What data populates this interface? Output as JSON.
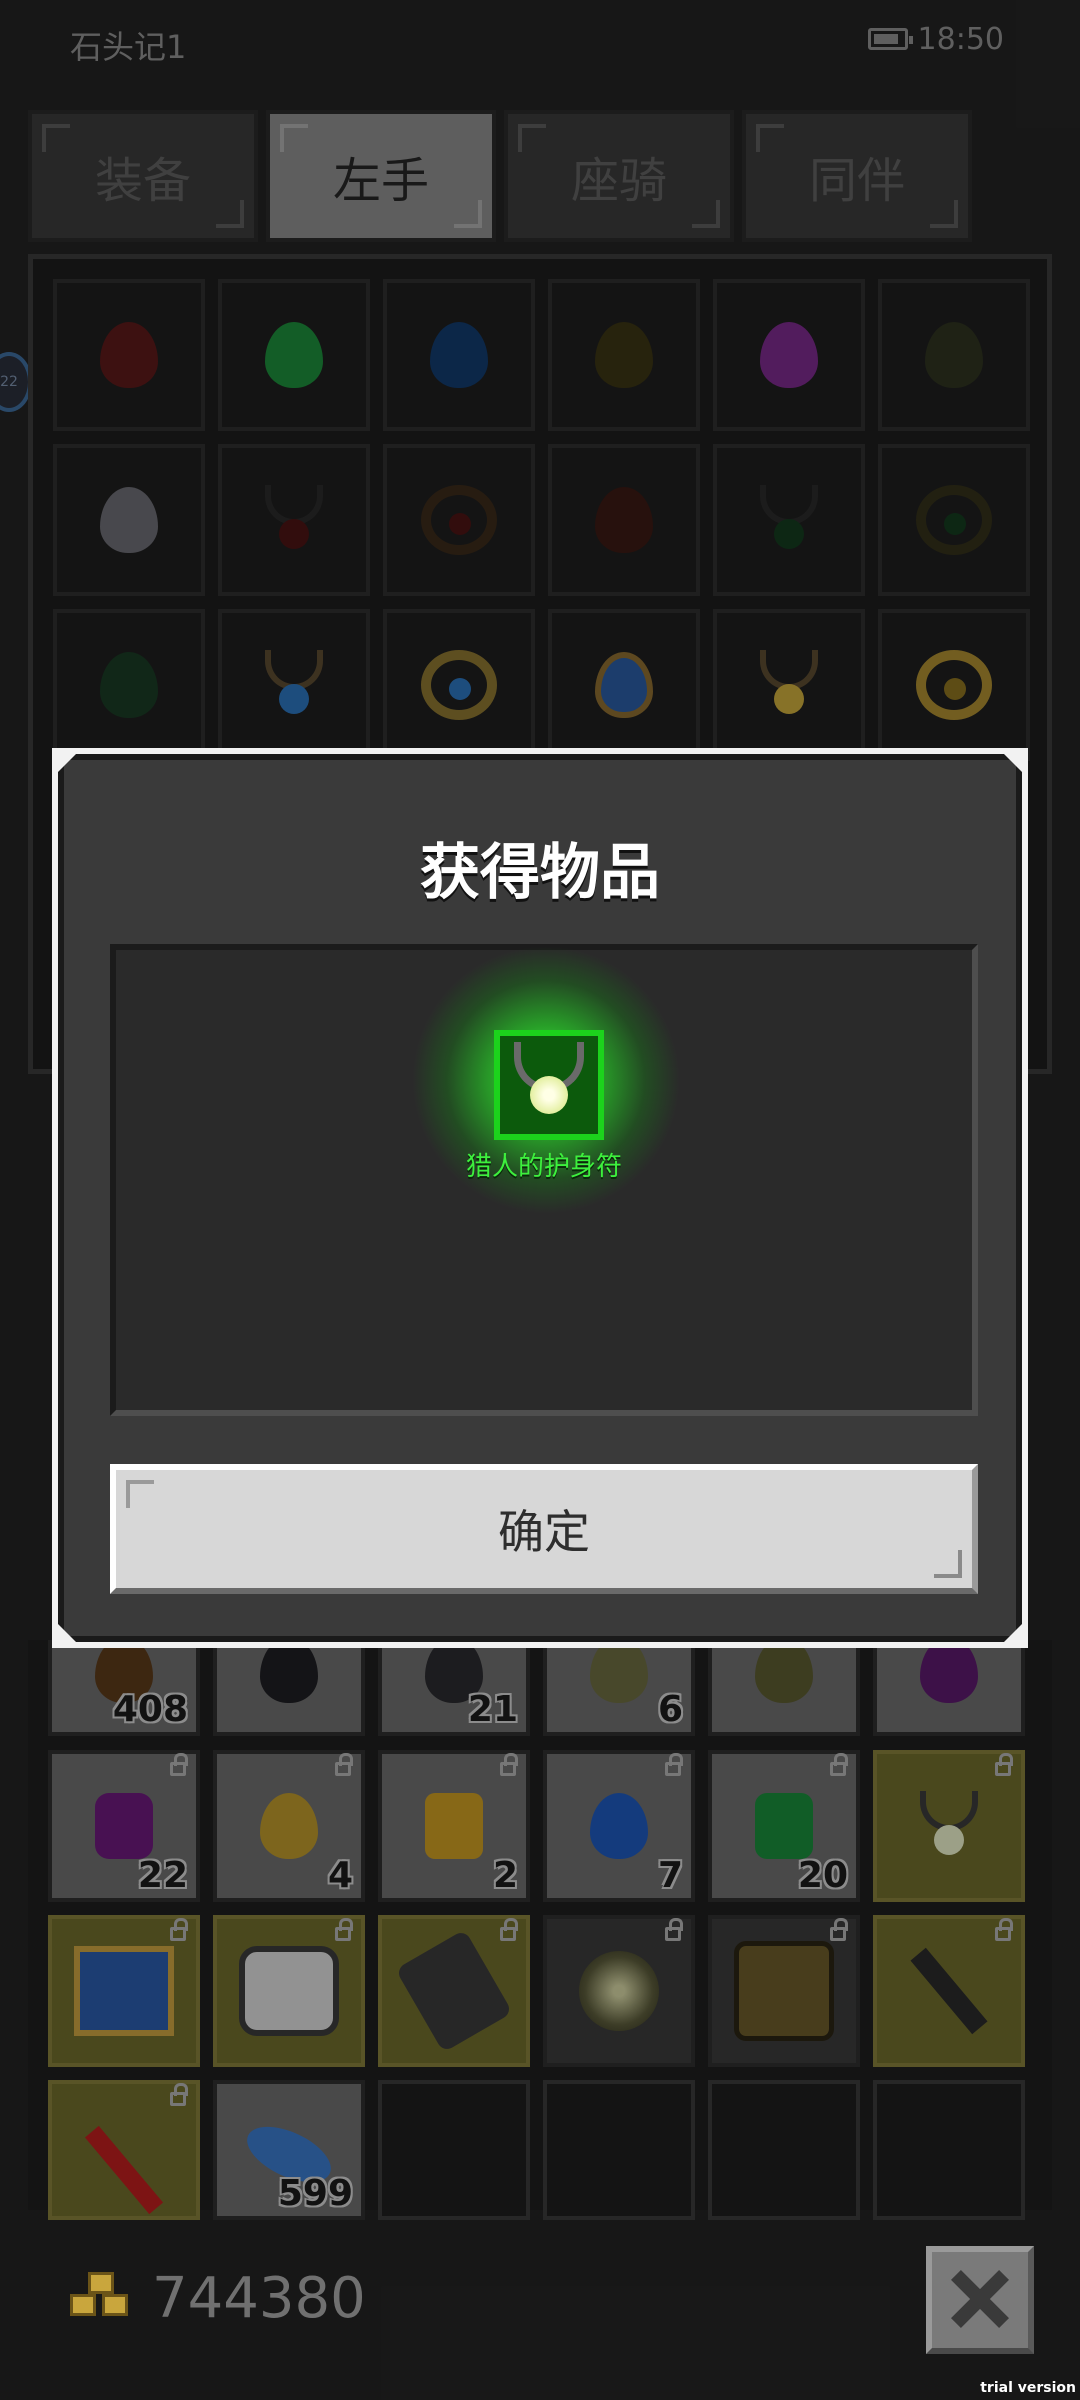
{
  "status": {
    "app_name": "石头记1",
    "time": "18:50"
  },
  "tabs": [
    {
      "label": "装备",
      "active": false
    },
    {
      "label": "左手",
      "active": true
    },
    {
      "label": "座骑",
      "active": false
    },
    {
      "label": "同伴",
      "active": false
    }
  ],
  "side_badge": "22",
  "dialog": {
    "title": "获得物品",
    "item_name": "猎人的护身符",
    "confirm_label": "确定"
  },
  "inventory_counts": {
    "row_a": [
      "408",
      "",
      "21",
      "6",
      "",
      ""
    ],
    "row_b": [
      "22",
      "4",
      "2",
      "7",
      "20",
      ""
    ],
    "row_d": [
      "",
      "599",
      "",
      "",
      "",
      ""
    ]
  },
  "gold": "744380",
  "watermark": "trial version",
  "colors": {
    "background": "#232323",
    "reward_glow": "#3df03d",
    "gold_cell": "#6e6a2c"
  }
}
